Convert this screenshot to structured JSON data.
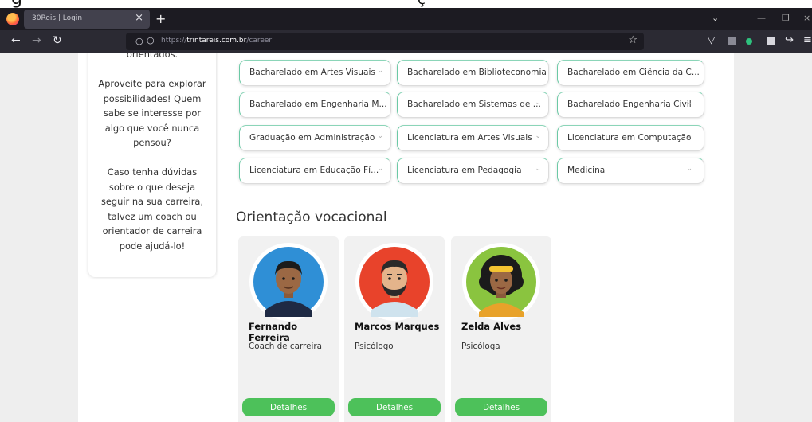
{
  "browser": {
    "tab_title": "30Reis | Login",
    "tab_close": "×",
    "new_tab": "+",
    "url_prefix": "https://",
    "url_domain": "trintareis.com.br",
    "url_path": "/career",
    "accent": "#ff7139"
  },
  "sidebar": {
    "text_top": "orientados.",
    "text_explore": "Aproveite para explorar\npossibilidades! Quem\nsabe se interesse por\nalgo que você nunca\npensou?",
    "text_help": "Caso tenha dúvidas\nsobre o que deseja\nseguir na sua carreira,\ntalvez um coach ou\norientador de carreira\npode ajudá-lo!"
  },
  "courses": [
    [
      "Bacharelado em Artes Visuais",
      "Bacharelado em Biblioteconomia",
      "Bacharelado em Ciência da C..."
    ],
    [
      "Bacharelado em Engenharia M...",
      "Bacharelado em Sistemas de ...",
      "Bacharelado Engenharia Civil"
    ],
    [
      "Graduação em Administração",
      "Licenciatura em Artes Visuais",
      "Licenciatura em Computação"
    ],
    [
      "Licenciatura em Educação Fí...",
      "Licenciatura em Pedagogia",
      "Medicina"
    ]
  ],
  "vocational": {
    "title": "Orientação vocacional",
    "coaches": [
      {
        "name": "Fernando Ferreira",
        "role": "Coach de carreira",
        "button": "Detalhes",
        "bg": "#2f8fd6"
      },
      {
        "name": "Marcos Marques",
        "role": "Psicólogo",
        "button": "Detalhes",
        "bg": "#e8432b"
      },
      {
        "name": "Zelda Alves",
        "role": "Psicóloga",
        "button": "Detalhes",
        "bg": "#8ac43f"
      }
    ],
    "button_color": "#4dc15a"
  }
}
